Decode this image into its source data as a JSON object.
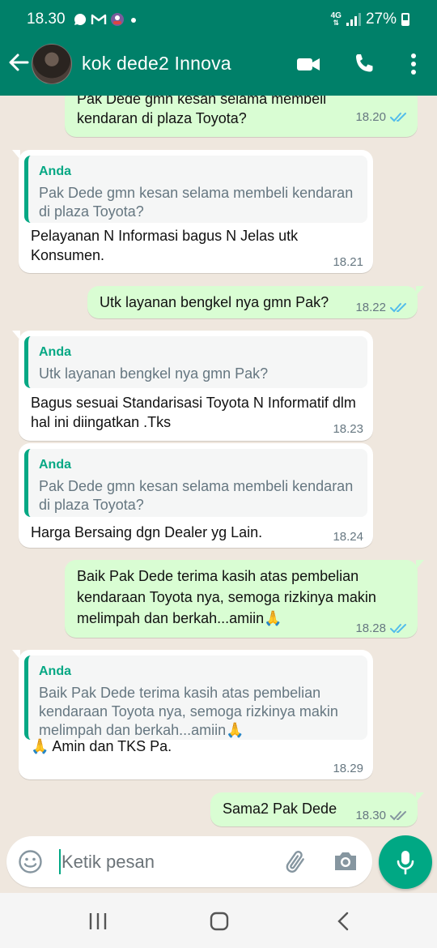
{
  "status_bar": {
    "time": "18.30",
    "network_type": "4G",
    "battery": "27%",
    "notification_icons": [
      "whatsapp-icon",
      "gmail-icon",
      "app-avatar-icon",
      "dot-icon"
    ]
  },
  "header": {
    "contact_name": "kok dede2 Innova",
    "icons": [
      "back-arrow-icon",
      "avatar",
      "video-call-icon",
      "voice-call-icon",
      "more-options-icon"
    ]
  },
  "messages": [
    {
      "dir": "out",
      "text": "Pak Dede gmn kesan selama membeli kendaran di plaza Toyota?",
      "time": "18.20",
      "status": "read"
    },
    {
      "dir": "in",
      "quote_author": "Anda",
      "quote_text": "Pak Dede gmn kesan selama membeli kendaran di plaza Toyota?",
      "text": "Pelayanan N Informasi bagus N Jelas utk Konsumen.",
      "time": "18.21"
    },
    {
      "dir": "out",
      "text": "Utk layanan bengkel nya gmn Pak?",
      "time": "18.22",
      "status": "read"
    },
    {
      "dir": "in",
      "quote_author": "Anda",
      "quote_text": "Utk layanan bengkel nya gmn Pak?",
      "text": "Bagus sesuai Standarisasi Toyota N Informatif dlm hal ini diingatkan .Tks",
      "time": "18.23"
    },
    {
      "dir": "in",
      "quote_author": "Anda",
      "quote_text": "Pak Dede gmn kesan selama membeli kendaran di plaza Toyota?",
      "text": "Harga Bersaing dgn Dealer yg Lain.",
      "time": "18.24"
    },
    {
      "dir": "out",
      "text": "Baik Pak Dede terima kasih atas pembelian kendaraan Toyota nya, semoga rizkinya  makin melimpah dan berkah...amiin🙏",
      "time": "18.28",
      "status": "read"
    },
    {
      "dir": "in",
      "quote_author": "Anda",
      "quote_text": "Baik Pak Dede terima kasih atas pembelian kendaraan Toyota nya, semoga rizkinya makin melimpah dan berkah...amiin🙏",
      "text": "🙏 Amin dan TKS Pa.",
      "time": "18.29"
    },
    {
      "dir": "out",
      "text": "Sama2 Pak Dede",
      "time": "18.30",
      "status": "delivered"
    }
  ],
  "composer": {
    "placeholder": "Ketik pesan"
  },
  "colors": {
    "header_green": "#008069",
    "outgoing_bubble": "#d9fdd3",
    "incoming_bubble": "#ffffff",
    "chat_background": "#efe7de",
    "read_ticks": "#53bdeb",
    "accent": "#00a884"
  },
  "nav_bar": {
    "icons": [
      "recent-apps-icon",
      "home-icon",
      "back-nav-icon"
    ]
  }
}
